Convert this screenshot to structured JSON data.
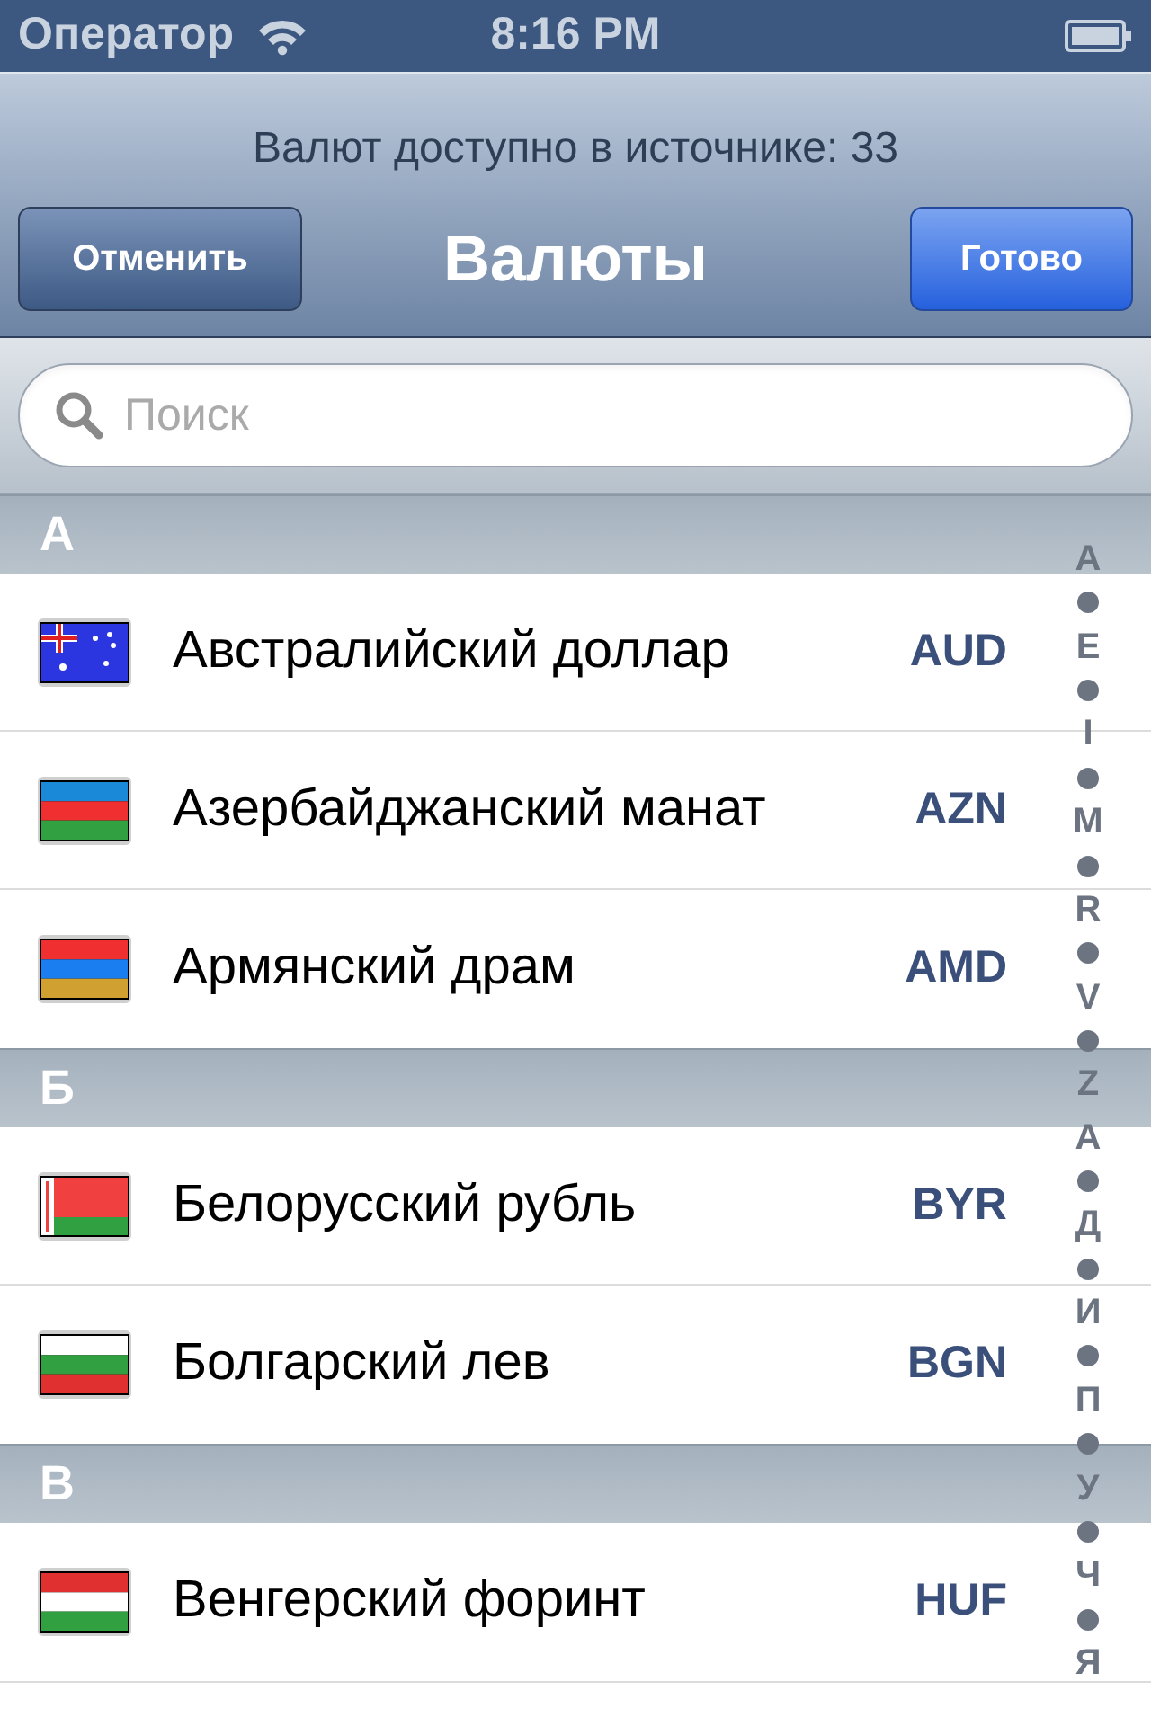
{
  "status_bar": {
    "carrier": "Оператор",
    "time": "8:16 PM"
  },
  "header": {
    "subtitle": "Валют доступно в источнике: 33",
    "title": "Валюты",
    "cancel": "Отменить",
    "done": "Готово"
  },
  "search": {
    "placeholder": "Поиск"
  },
  "sections": [
    {
      "letter": "А",
      "items": [
        {
          "name": "Австралийский доллар",
          "code": "AUD",
          "flag": {
            "kind": "union",
            "stripes": [
              {
                "color": "#2b35e0"
              }
            ]
          }
        },
        {
          "name": "Азербайджанский манат",
          "code": "AZN",
          "flag": {
            "kind": "stripes",
            "stripes": [
              {
                "color": "#1a8ad8"
              },
              {
                "color": "#f03030"
              },
              {
                "color": "#30a040"
              }
            ]
          }
        },
        {
          "name": "Армянский драм",
          "code": "AMD",
          "flag": {
            "kind": "stripes",
            "stripes": [
              {
                "color": "#f03030"
              },
              {
                "color": "#1a7ef0"
              },
              {
                "color": "#d0a030"
              }
            ]
          }
        }
      ]
    },
    {
      "letter": "Б",
      "items": [
        {
          "name": "Белорусский рубль",
          "code": "BYR",
          "flag": {
            "kind": "ornament",
            "stripes": [
              {
                "color": "#f04040"
              },
              {
                "color": "#30a040"
              }
            ]
          }
        },
        {
          "name": "Болгарский лев",
          "code": "BGN",
          "flag": {
            "kind": "stripes",
            "stripes": [
              {
                "color": "#ffffff"
              },
              {
                "color": "#30a040"
              },
              {
                "color": "#e03030"
              }
            ]
          }
        }
      ]
    },
    {
      "letter": "В",
      "items": [
        {
          "name": "Венгерский форинт",
          "code": "HUF",
          "flag": {
            "kind": "stripes",
            "stripes": [
              {
                "color": "#e03030"
              },
              {
                "color": "#ffffff"
              },
              {
                "color": "#30a040"
              }
            ]
          }
        }
      ]
    }
  ],
  "index": [
    {
      "kind": "letter",
      "text": "A"
    },
    {
      "kind": "dot"
    },
    {
      "kind": "letter",
      "text": "E"
    },
    {
      "kind": "dot"
    },
    {
      "kind": "letter",
      "text": "I"
    },
    {
      "kind": "dot"
    },
    {
      "kind": "letter",
      "text": "M"
    },
    {
      "kind": "dot"
    },
    {
      "kind": "letter",
      "text": "R"
    },
    {
      "kind": "dot"
    },
    {
      "kind": "letter",
      "text": "V"
    },
    {
      "kind": "dot"
    },
    {
      "kind": "letter",
      "text": "Z"
    },
    {
      "kind": "letter",
      "text": "А"
    },
    {
      "kind": "dot"
    },
    {
      "kind": "letter",
      "text": "Д"
    },
    {
      "kind": "dot"
    },
    {
      "kind": "letter",
      "text": "И"
    },
    {
      "kind": "dot"
    },
    {
      "kind": "letter",
      "text": "П"
    },
    {
      "kind": "dot"
    },
    {
      "kind": "letter",
      "text": "У"
    },
    {
      "kind": "dot"
    },
    {
      "kind": "letter",
      "text": "Ч"
    },
    {
      "kind": "dot"
    },
    {
      "kind": "letter",
      "text": "Я"
    }
  ]
}
